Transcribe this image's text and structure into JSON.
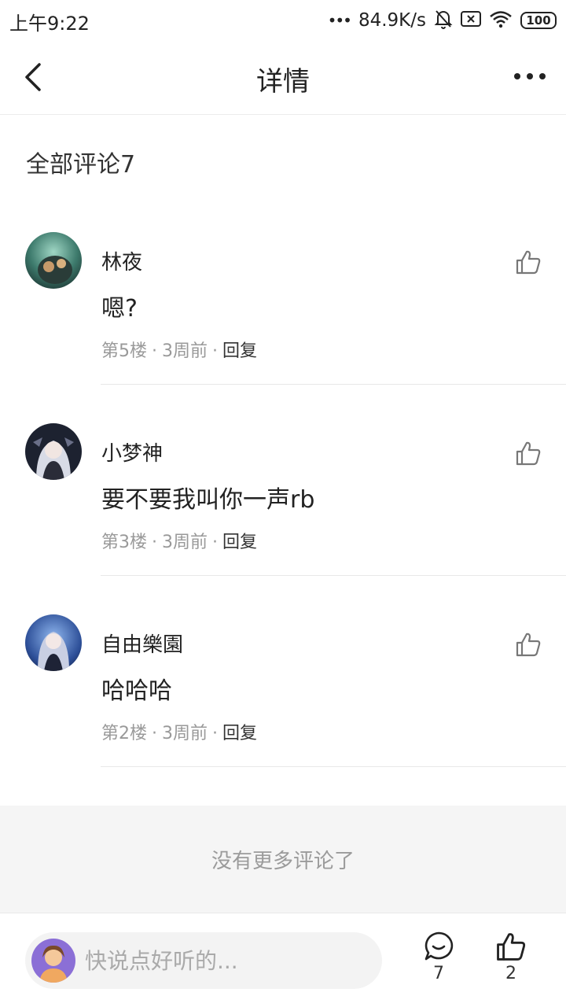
{
  "status_bar": {
    "time": "上午9:22",
    "speed": "84.9K/s",
    "battery": "100"
  },
  "header": {
    "title": "详情",
    "back_icon": "chevron-left-icon",
    "more_icon": "more-horizontal-icon"
  },
  "comments_section": {
    "title": "全部评论7"
  },
  "comments": [
    {
      "name": "林夜",
      "text": "嗯?",
      "floor": "第5楼",
      "time": "3周前",
      "reply": "回复"
    },
    {
      "name": "小梦神",
      "text": "要不要我叫你一声rb",
      "floor": "第3楼",
      "time": "3周前",
      "reply": "回复"
    },
    {
      "name": "自由樂園",
      "text": "哈哈哈",
      "floor": "第2楼",
      "time": "3周前",
      "reply": "回复"
    }
  ],
  "no_more_text": "没有更多评论了",
  "bottom_bar": {
    "input_placeholder": "快说点好听的...",
    "comment_count": "7",
    "like_count": "2"
  },
  "colors": {
    "text": "#222222",
    "meta": "#999999",
    "divider": "#e8e8e8",
    "footer_bg": "#f5f5f5",
    "input_bg": "#f3f3f3"
  }
}
